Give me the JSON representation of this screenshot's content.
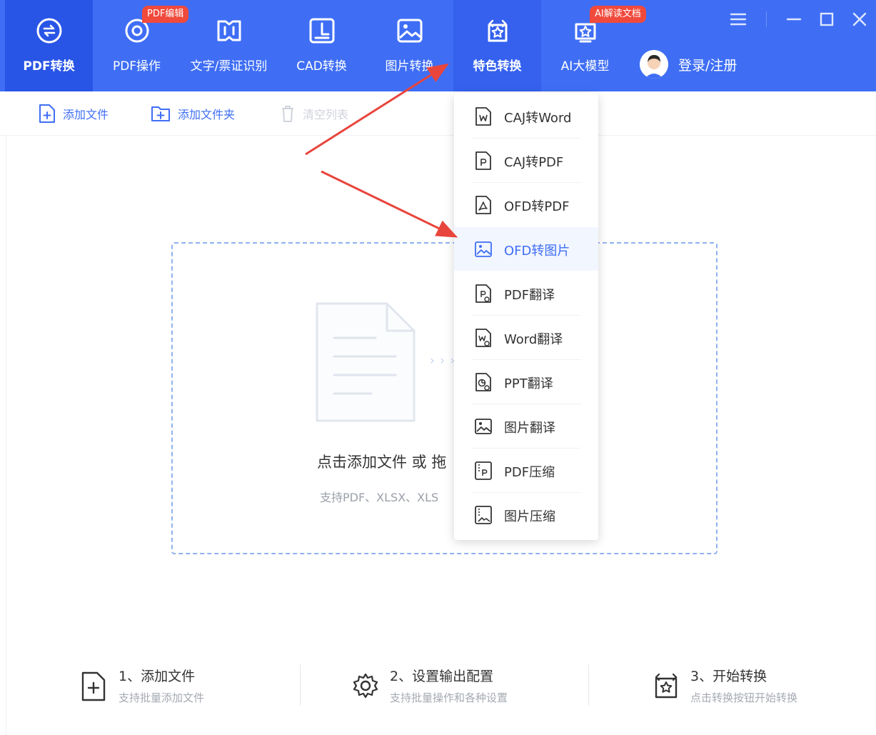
{
  "colors": {
    "accent": "#3f6ef5",
    "active_tab": "#2955e6",
    "tag_red": "#f04a3c",
    "annotation_arrow": "#e8453c"
  },
  "nav": {
    "tabs": [
      {
        "label": "PDF转换",
        "icon": "pdf-convert-icon",
        "state": "active"
      },
      {
        "label": "PDF操作",
        "icon": "pdf-operate-icon",
        "tag": "PDF编辑"
      },
      {
        "label": "文字/票证识别",
        "icon": "ocr-scan-icon"
      },
      {
        "label": "CAD转换",
        "icon": "cad-convert-icon"
      },
      {
        "label": "图片转换",
        "icon": "image-convert-icon"
      },
      {
        "label": "特色转换",
        "icon": "special-convert-icon",
        "state": "highlighted"
      },
      {
        "label": "AI大模型",
        "icon": "ai-model-icon",
        "tag": "AI解读文档"
      }
    ],
    "user_label": "登录/注册"
  },
  "window_controls": [
    "menu-icon",
    "minimize-icon",
    "maximize-icon",
    "close-icon"
  ],
  "toolbar": {
    "add_file": "添加文件",
    "add_folder": "添加文件夹",
    "clear_list": "清空列表"
  },
  "dropzone": {
    "arrows": "› › ›",
    "title": "点击添加文件 或 拖",
    "subtitle": "支持PDF、XLSX、XLS"
  },
  "dropdown": {
    "items": [
      {
        "label": "CAJ转Word",
        "icon": "word-file-icon"
      },
      {
        "label": "CAJ转PDF",
        "icon": "pdf-file-icon"
      },
      {
        "label": "OFD转PDF",
        "icon": "acrobat-file-icon"
      },
      {
        "label": "OFD转图片",
        "icon": "image-file-icon",
        "selected": true
      },
      {
        "label": "PDF翻译",
        "icon": "pdf-translate-icon"
      },
      {
        "label": "Word翻译",
        "icon": "word-translate-icon"
      },
      {
        "label": "PPT翻译",
        "icon": "ppt-translate-icon"
      },
      {
        "label": "图片翻译",
        "icon": "image-translate-icon"
      },
      {
        "label": "PDF压缩",
        "icon": "pdf-compress-icon"
      },
      {
        "label": "图片压缩",
        "icon": "image-compress-icon"
      }
    ]
  },
  "steps": [
    {
      "title": "1、添加文件",
      "subtitle": "支持批量添加文件",
      "icon": "add-file-icon"
    },
    {
      "title": "2、设置输出配置",
      "subtitle": "支持批量操作和各种设置",
      "icon": "settings-gear-icon"
    },
    {
      "title": "3、开始转换",
      "subtitle": "点击转换按钮开始转换",
      "icon": "convert-start-icon"
    }
  ]
}
